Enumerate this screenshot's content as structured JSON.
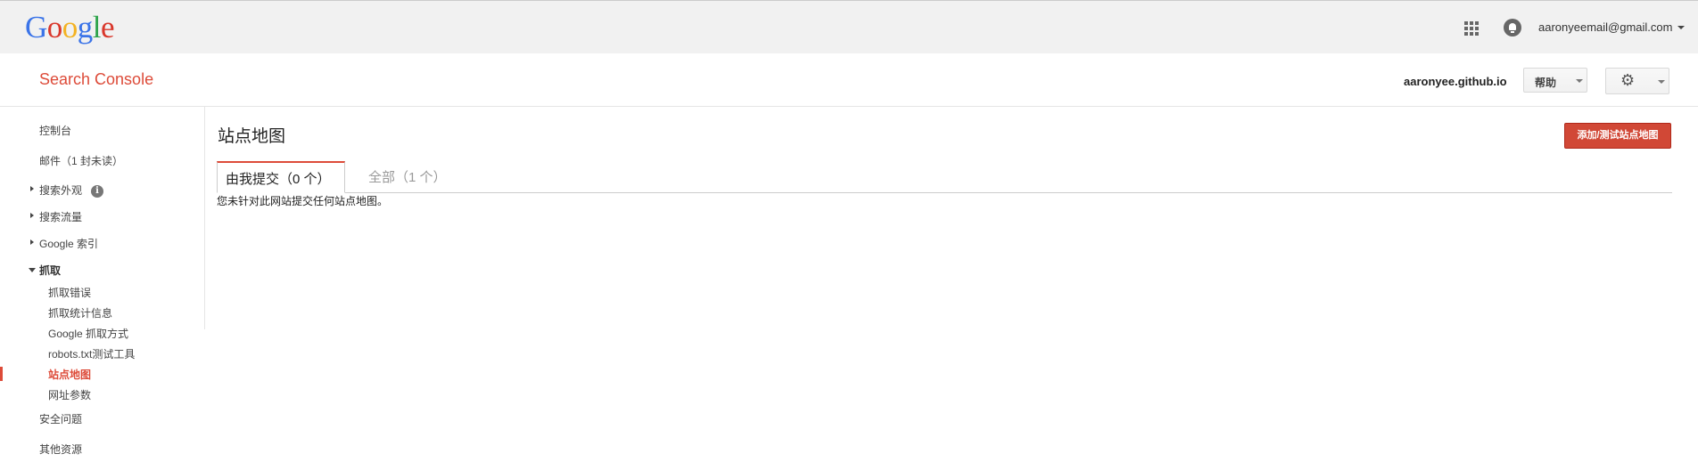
{
  "logo": {
    "letters": [
      "G",
      "o",
      "o",
      "g",
      "l",
      "e"
    ],
    "colors": [
      "#3b74e8",
      "#d9372b",
      "#f3b222",
      "#3b74e8",
      "#2ea44b",
      "#d9372b"
    ]
  },
  "topbar": {
    "apps_icon": "apps-grid-icon",
    "notifications_icon": "bell-icon",
    "account_email": "aaronyeemail@gmail.com"
  },
  "header": {
    "product": "Search Console",
    "site": "aaronyee.github.io",
    "help_label": "帮助",
    "settings_icon": "gear-icon"
  },
  "nav": {
    "dashboard": "控制台",
    "messages": "邮件（1 封未读）",
    "search_appearance": "搜索外观",
    "search_traffic": "搜索流量",
    "google_index": "Google 索引",
    "crawl": "抓取",
    "crawl_items": [
      "抓取错误",
      "抓取统计信息",
      "Google 抓取方式",
      "robots.txt测试工具",
      "站点地图",
      "网址参数"
    ],
    "security": "安全问题",
    "other_resources": "其他资源"
  },
  "main": {
    "title": "站点地图",
    "add_button": "添加/测试站点地图",
    "tabs": [
      "由我提交（0 个）",
      "全部（1 个）"
    ],
    "empty_message": "您未针对此网站提交任何站点地图。"
  },
  "colors": {
    "accent": "#dd4b39",
    "add_button": "#d14836"
  }
}
